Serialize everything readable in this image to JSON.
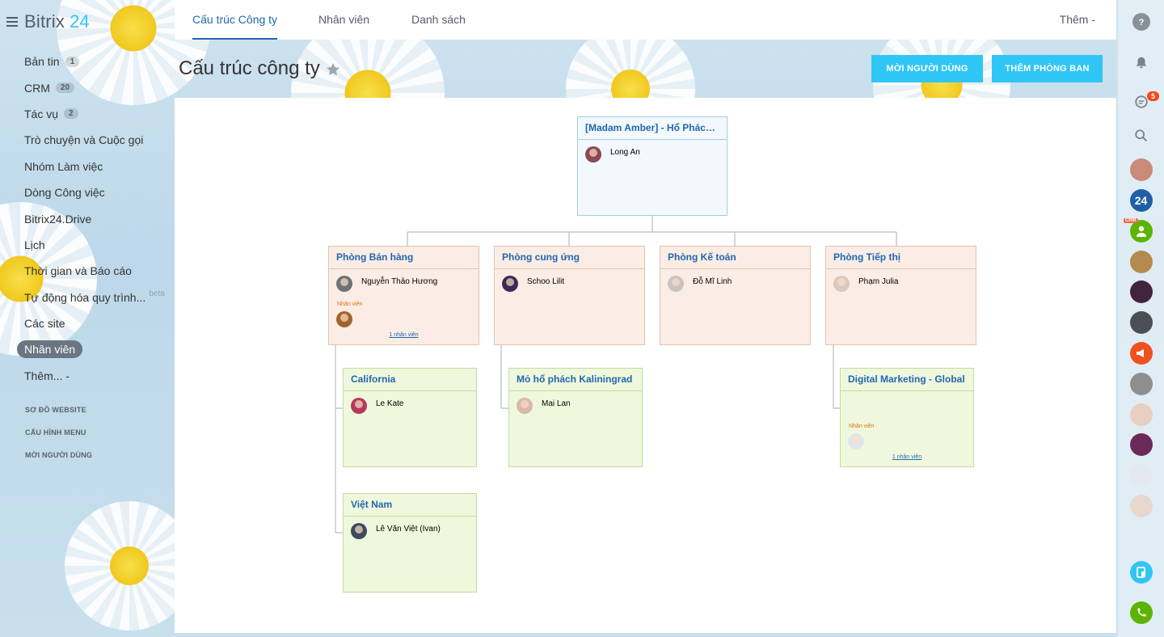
{
  "app": {
    "logo_text": "Bitrix",
    "logo_num": "24"
  },
  "sidebar": {
    "items": [
      {
        "label": "Bản tin",
        "count": "1"
      },
      {
        "label": "CRM",
        "count": "20"
      },
      {
        "label": "Tác vụ",
        "count": "2"
      },
      {
        "label": "Trò chuyện và Cuộc gọi"
      },
      {
        "label": "Nhóm Làm việc"
      },
      {
        "label": "Dòng Công việc"
      },
      {
        "label": "Bitrix24.Drive"
      },
      {
        "label": "Lịch"
      },
      {
        "label": "Thời gian và Báo cáo"
      },
      {
        "label": "Tự động hóa quy trình...",
        "beta": "beta"
      },
      {
        "label": "Các site"
      },
      {
        "label": "Nhân viên",
        "active": true
      },
      {
        "label": "Thêm... -"
      }
    ],
    "links": [
      "SƠ ĐỒ WEBSITE",
      "CẤU HÌNH MENU",
      "MỜI NGƯỜI DÙNG"
    ]
  },
  "tabs": [
    {
      "label": "Cấu trúc Công ty",
      "active": true
    },
    {
      "label": "Nhân viên"
    },
    {
      "label": "Danh sách"
    }
  ],
  "tabs_more": "Thêm -",
  "page": {
    "title": "Cấu trúc công ty",
    "invite_button": "MỜI NGƯỜI DÙNG",
    "add_department_button": "THÊM PHÒNG BAN"
  },
  "org": {
    "root": {
      "title": "[Madam Amber] - Hổ Phách ...",
      "head": "Long An"
    },
    "departments": [
      {
        "title": "Phòng Bán hàng",
        "head": "Nguyễn Thảo Hương",
        "employee_label": "Nhân viên",
        "employee_link": "1 nhân viên"
      },
      {
        "title": "Phòng cung ứng",
        "head": "Schoo Lilit"
      },
      {
        "title": "Phòng Kế toán",
        "head": "Đỗ Mĩ Linh"
      },
      {
        "title": "Phòng Tiếp thị",
        "head": "Phạm Julia"
      }
    ],
    "subdepartments": [
      {
        "title": "California",
        "head": "Le Kate"
      },
      {
        "title": "Việt Nam",
        "head": "Lê Văn Việt (Ivan)"
      },
      {
        "title": "Mỏ hổ phách Kaliningrad",
        "head": "Mai Lan"
      },
      {
        "title": "Digital Marketing - Global",
        "employee_label": "Nhân viên",
        "employee_link": "1 nhân viên"
      }
    ]
  },
  "rail": {
    "notification_count": "5",
    "crm_tag": "CRM",
    "b24_label": "24"
  },
  "icons": {
    "help": "question-circle-icon",
    "notifications": "bell-icon",
    "chat": "chat-bubbles-icon",
    "search": "magnifier-icon",
    "star": "star-icon",
    "telephony": "phone-icon",
    "calendar_task": "document-icon"
  },
  "colors": {
    "accent": "#2fc6f6",
    "link": "#2067b0",
    "level1_bg": "#fbede5",
    "level2_bg": "#eff8dc",
    "root_bg": "#f2f8fb"
  }
}
